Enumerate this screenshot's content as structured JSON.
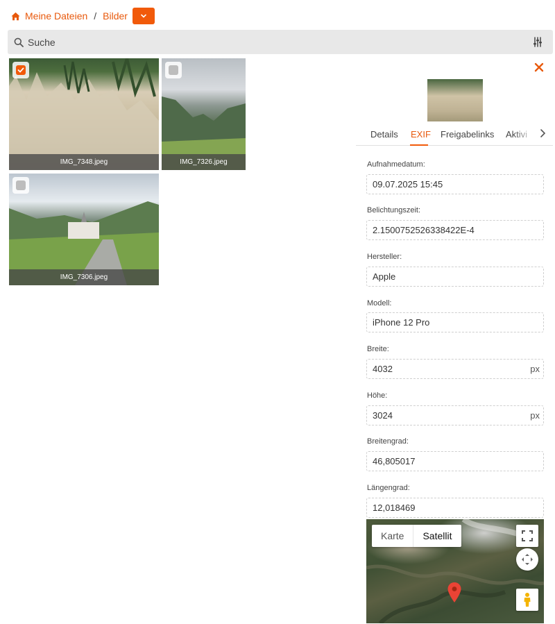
{
  "breadcrumb": {
    "home": "Meine Dateien",
    "separator": "/",
    "current": "Bilder"
  },
  "search": {
    "placeholder": "Suche"
  },
  "files": [
    {
      "name": "IMG_7348.jpeg",
      "checked": true
    },
    {
      "name": "IMG_7326.jpeg",
      "checked": false
    },
    {
      "name": "IMG_7306.jpeg",
      "checked": false
    }
  ],
  "details": {
    "tabs": [
      "Details",
      "EXIF",
      "Freigabelinks",
      "Aktivi"
    ],
    "active_tab": "EXIF",
    "exif": [
      {
        "label": "Aufnahmedatum:",
        "value": "09.07.2025 15:45",
        "unit": ""
      },
      {
        "label": "Belichtungszeit:",
        "value": "2.1500752526338422E-4",
        "unit": ""
      },
      {
        "label": "Hersteller:",
        "value": "Apple",
        "unit": ""
      },
      {
        "label": "Modell:",
        "value": "iPhone 12 Pro",
        "unit": ""
      },
      {
        "label": "Breite:",
        "value": "4032",
        "unit": "px"
      },
      {
        "label": "Höhe:",
        "value": "3024",
        "unit": "px"
      },
      {
        "label": "Breitengrad:",
        "value": "46,805017",
        "unit": ""
      },
      {
        "label": "Längengrad:",
        "value": "12,018469",
        "unit": ""
      }
    ],
    "map": {
      "type_map": "Karte",
      "type_satellite": "Satellit"
    }
  },
  "colors": {
    "accent": "#f15a0a",
    "accent_text": "#e8590c"
  }
}
